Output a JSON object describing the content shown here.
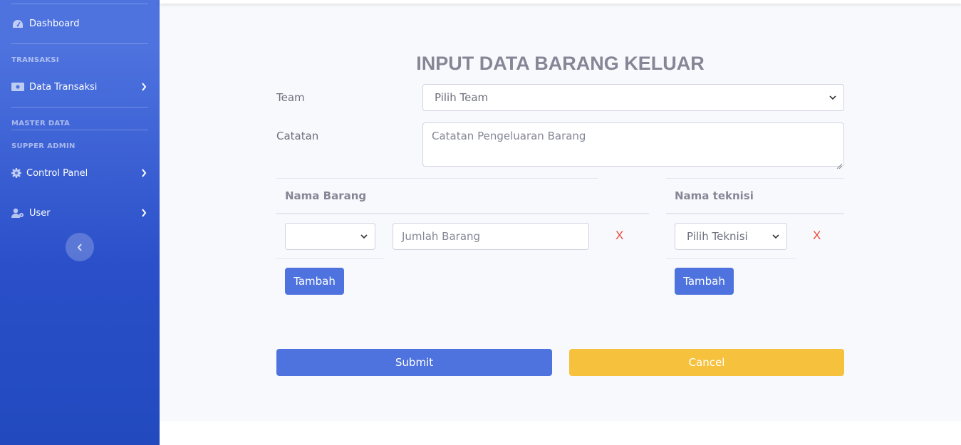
{
  "sidebar": {
    "dashboard": {
      "label": "Dashboard",
      "icon": "tachometer-icon"
    },
    "heading_transaksi": "TRANSAKSI",
    "data_transaksi": {
      "label": "Data Transaksi",
      "icon": "money-bill-icon"
    },
    "heading_master": "MASTER DATA",
    "heading_supper": "SUPPER ADMIN",
    "control_panel": {
      "label": "Control Panel",
      "icon": "gear-icon"
    },
    "user": {
      "label": "User",
      "icon": "user-cog-icon"
    }
  },
  "page": {
    "title": "INPUT DATA BARANG KELUAR"
  },
  "form": {
    "team_label": "Team",
    "team_select": "Pilih Team",
    "catatan_label": "Catatan",
    "catatan_placeholder": "Catatan Pengeluaran Barang"
  },
  "barang_table": {
    "header": "Nama Barang",
    "row": {
      "barang_select": "",
      "jumlah_placeholder": "Jumlah Barang",
      "remove": "X"
    },
    "add_button": "Tambah"
  },
  "teknisi_table": {
    "header": "Nama teknisi",
    "row": {
      "teknisi_select": "Pilih Teknisi",
      "remove": "X"
    },
    "add_button": "Tambah"
  },
  "actions": {
    "submit": "Submit",
    "cancel": "Cancel"
  },
  "colors": {
    "primary": "#4e73df",
    "warning": "#f6c23e",
    "danger": "#e74a3b",
    "text_muted": "#858796"
  }
}
